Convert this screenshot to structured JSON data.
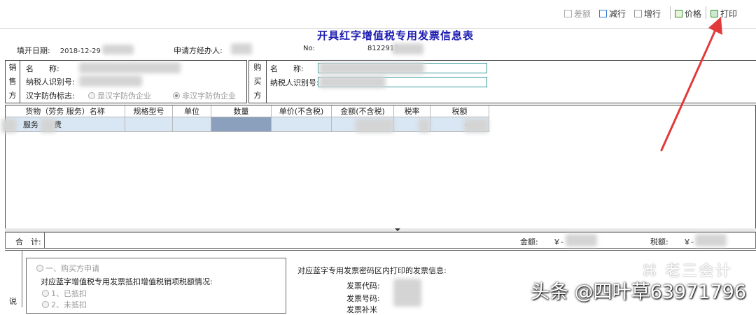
{
  "toolbar": {
    "diff_label": "差额",
    "delete_row_label": "减行",
    "add_row_label": "增行",
    "price_label": "价格",
    "print_label": "打印"
  },
  "form_title": "开具红字增值税专用发票信息表",
  "meta": {
    "fill_date_label": "填开日期:",
    "fill_date_value": "2018-12-29",
    "agent_label": "申请方经办人:",
    "no_label": "No:",
    "no_value": "8122913"
  },
  "seller": {
    "side_label": [
      "销",
      "售",
      "方"
    ],
    "name_label": "名　　称:",
    "tax_id_label": "纳税人识别号:",
    "anti_fake_label": "汉字防伪标志:",
    "option_yes": "是汉字防伪企业",
    "option_no": "非汉字防伪企业"
  },
  "buyer": {
    "side_label": [
      "购",
      "买",
      "方"
    ],
    "name_label": "名　　称:",
    "tax_id_label": "纳税人识别号:"
  },
  "table": {
    "headers": [
      "货物（劳务 服务）名称",
      "规格型号",
      "单位",
      "数量",
      "单价(不含税)",
      "金额(不含税)",
      "税率",
      "税额"
    ],
    "row": {
      "name": "服务　　费",
      "amount": "-",
      "tax": "-"
    }
  },
  "totals": {
    "label": "合　计:",
    "amount_label": "金额:",
    "amount_prefix": "￥-",
    "tax_label": "税额:",
    "tax_prefix": "￥-"
  },
  "notes": {
    "side_label": "说",
    "option_buyer_apply": "一、购买方申请",
    "deduction_question": "对应蓝字增值税专用发票抵扣增值税销项税额情况:",
    "option_deducted": "1、已抵扣",
    "option_not_deducted": "2、未抵扣",
    "blue_invoice_info": "对应蓝字专用发票密码区内打印的发票信息:",
    "invoice_code_label": "发票代码:",
    "invoice_number_label": "发票号码:",
    "partial_label": "发票补米"
  },
  "watermark": {
    "wechat_name": "老三会计",
    "credit": "头条 @四叶草63971796"
  },
  "colors": {
    "title_blue": "#1b1bb0",
    "row_fill": "#d9e6f3",
    "selected_cell": "#8aa0bd",
    "input_border": "#3a9a9a",
    "annotation_red": "#e23a3a"
  }
}
